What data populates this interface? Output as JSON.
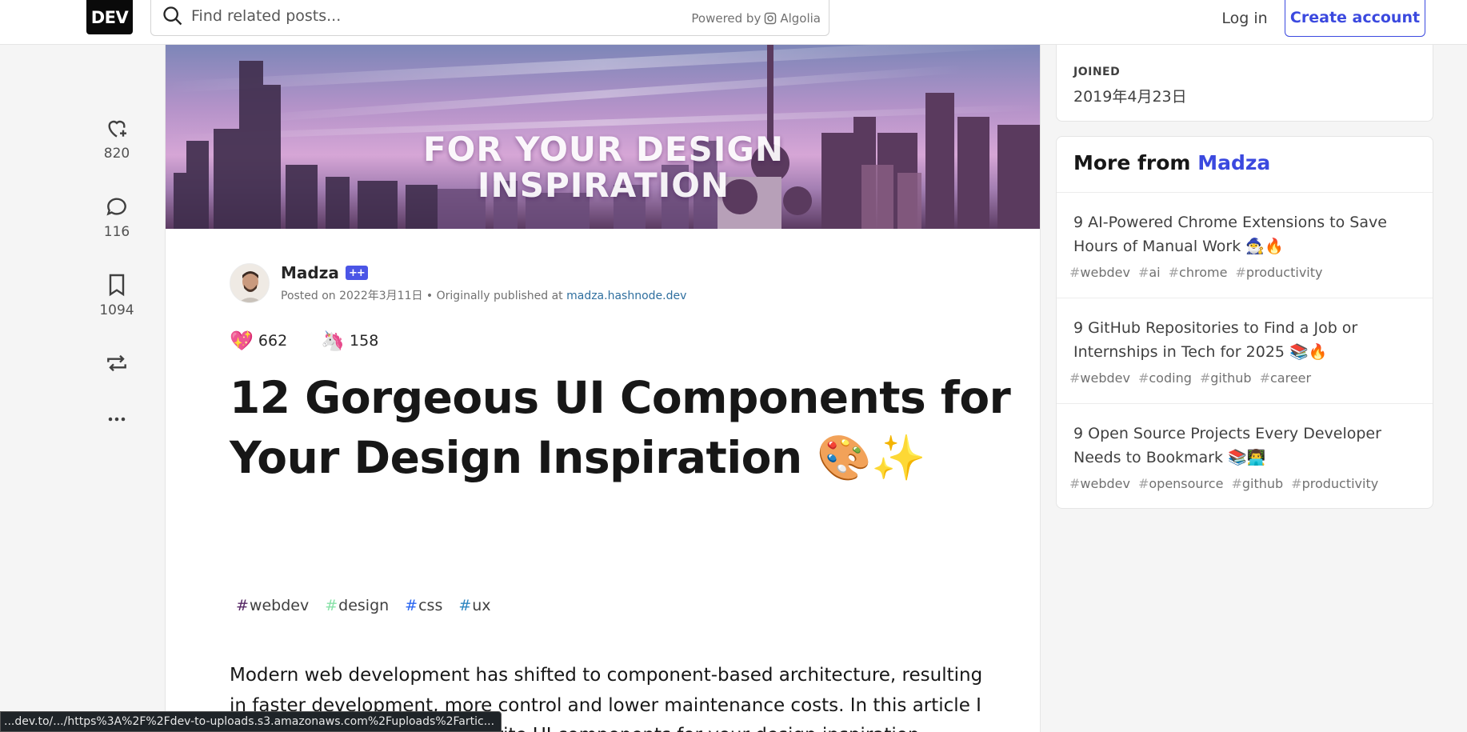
{
  "header": {
    "logo": "DEV",
    "search_placeholder": "Find related posts...",
    "powered_by": "Powered by",
    "algolia": "Algolia",
    "login": "Log in",
    "create_account": "Create account"
  },
  "rail": {
    "likes": "820",
    "comments": "116",
    "saves": "1094"
  },
  "article": {
    "cover_line1": "FOR YOUR DESIGN",
    "cover_line2": "INSPIRATION",
    "author": "Madza",
    "posted_prefix": "Posted on 2022年3月11日 • Originally published at ",
    "posted_link": "madza.hashnode.dev",
    "reactions": [
      {
        "emoji": "💖",
        "count": "662"
      },
      {
        "emoji": "🦄",
        "count": "158"
      }
    ],
    "title": "12 Gorgeous UI Components for Your Design Inspiration 🎨✨",
    "tags": [
      {
        "name": "webdev",
        "color": "#562765"
      },
      {
        "name": "design",
        "color": "#88e2a8"
      },
      {
        "name": "css",
        "color": "#2965f1"
      },
      {
        "name": "ux",
        "color": "#2e86c1"
      }
    ],
    "body": "Modern web development has shifted to component-based architecture, resulting in faster development, more control and lower maintenance costs. In this article I handpicked some of my favorite UI components for your design inspiration."
  },
  "sidebar": {
    "joined_label": "JOINED",
    "joined_date": "2019年4月23日",
    "more_from": "More from",
    "more_name": "Madza",
    "posts": [
      {
        "title": "9 AI-Powered Chrome Extensions to Save Hours of Manual Work 🧙‍♂️🔥",
        "tags": [
          "webdev",
          "ai",
          "chrome",
          "productivity"
        ]
      },
      {
        "title": "9 GitHub Repositories to Find a Job or Internships in Tech for 2025 📚🔥",
        "tags": [
          "webdev",
          "coding",
          "github",
          "career"
        ]
      },
      {
        "title": "9 Open Source Projects Every Developer Needs to Bookmark 📚👨‍💻",
        "tags": [
          "webdev",
          "opensource",
          "github",
          "productivity"
        ]
      }
    ]
  },
  "statusbar": "...dev.to/.../https%3A%2F%2Fdev-to-uploads.s3.amazonaws.com%2Fuploads%2Fartic..."
}
